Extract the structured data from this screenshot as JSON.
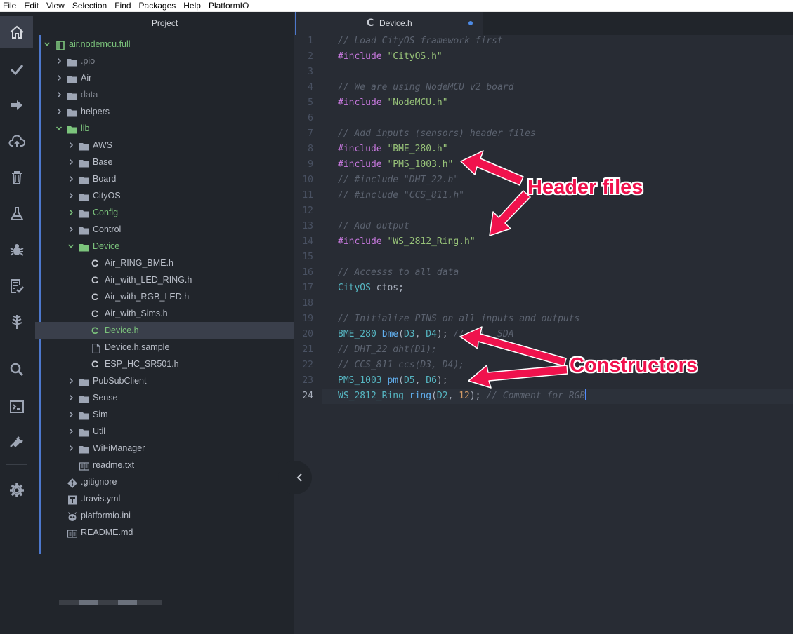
{
  "menubar": {
    "items": [
      "File",
      "Edit",
      "View",
      "Selection",
      "Find",
      "Packages",
      "Help",
      "PlatformIO"
    ]
  },
  "activitybar": {
    "icons": [
      "home-icon",
      "check-icon",
      "arrow-right-icon",
      "cloud-upload-icon",
      "trash-icon",
      "flask-icon",
      "bug-icon",
      "checklist-icon",
      "tree-icon",
      "search-icon",
      "terminal-icon",
      "plug-icon",
      "gear-icon"
    ]
  },
  "sidebar": {
    "title": "Project",
    "tree": [
      {
        "label": "air.nodemcu.full",
        "kind": "project",
        "depth": 0,
        "expanded": true,
        "color": "green"
      },
      {
        "label": ".pio",
        "kind": "folder",
        "depth": 1,
        "expanded": false,
        "color": "dim"
      },
      {
        "label": "Air",
        "kind": "folder",
        "depth": 1,
        "expanded": false
      },
      {
        "label": "data",
        "kind": "folder",
        "depth": 1,
        "expanded": false,
        "color": "dim"
      },
      {
        "label": "helpers",
        "kind": "folder",
        "depth": 1,
        "expanded": false
      },
      {
        "label": "lib",
        "kind": "folder",
        "depth": 1,
        "expanded": true,
        "color": "green"
      },
      {
        "label": "AWS",
        "kind": "folder",
        "depth": 2,
        "expanded": false
      },
      {
        "label": "Base",
        "kind": "folder",
        "depth": 2,
        "expanded": false
      },
      {
        "label": "Board",
        "kind": "folder",
        "depth": 2,
        "expanded": false
      },
      {
        "label": "CityOS",
        "kind": "folder",
        "depth": 2,
        "expanded": false
      },
      {
        "label": "Config",
        "kind": "folder",
        "depth": 2,
        "expanded": false,
        "color": "green"
      },
      {
        "label": "Control",
        "kind": "folder",
        "depth": 2,
        "expanded": false
      },
      {
        "label": "Device",
        "kind": "folder",
        "depth": 2,
        "expanded": true,
        "color": "green"
      },
      {
        "label": "Air_RING_BME.h",
        "kind": "cfile",
        "depth": 3
      },
      {
        "label": "Air_with_LED_RING.h",
        "kind": "cfile",
        "depth": 3
      },
      {
        "label": "Air_with_RGB_LED.h",
        "kind": "cfile",
        "depth": 3
      },
      {
        "label": "Air_with_Sims.h",
        "kind": "cfile",
        "depth": 3
      },
      {
        "label": "Device.h",
        "kind": "cfile",
        "depth": 3,
        "selected": true,
        "color": "green"
      },
      {
        "label": "Device.h.sample",
        "kind": "file",
        "depth": 3
      },
      {
        "label": "ESP_HC_SR501.h",
        "kind": "cfile",
        "depth": 3
      },
      {
        "label": "PubSubClient",
        "kind": "folder",
        "depth": 2,
        "expanded": false
      },
      {
        "label": "Sense",
        "kind": "folder",
        "depth": 2,
        "expanded": false
      },
      {
        "label": "Sim",
        "kind": "folder",
        "depth": 2,
        "expanded": false
      },
      {
        "label": "Util",
        "kind": "folder",
        "depth": 2,
        "expanded": false
      },
      {
        "label": "WiFiManager",
        "kind": "folder",
        "depth": 2,
        "expanded": false
      },
      {
        "label": "readme.txt",
        "kind": "book",
        "depth": 2
      },
      {
        "label": ".gitignore",
        "kind": "git",
        "depth": 1
      },
      {
        "label": ".travis.yml",
        "kind": "yml",
        "depth": 1
      },
      {
        "label": "platformio.ini",
        "kind": "alien",
        "depth": 1
      },
      {
        "label": "README.md",
        "kind": "book",
        "depth": 1
      }
    ]
  },
  "tab": {
    "label": "Device.h",
    "icon": "c-file-icon",
    "modified": true
  },
  "editor": {
    "current_line": 24,
    "lines": [
      [
        [
          "cm",
          "// Load CityOS framework first"
        ]
      ],
      [
        [
          "k",
          "#include"
        ],
        [
          "p",
          " "
        ],
        [
          "s",
          "\"CityOS.h\""
        ]
      ],
      [],
      [
        [
          "cm",
          "// We are using NodeMCU v2 board"
        ]
      ],
      [
        [
          "k",
          "#include"
        ],
        [
          "p",
          " "
        ],
        [
          "s",
          "\"NodeMCU.h\""
        ]
      ],
      [],
      [
        [
          "cm",
          "// Add inputs (sensors) header files"
        ]
      ],
      [
        [
          "k",
          "#include"
        ],
        [
          "p",
          " "
        ],
        [
          "s",
          "\"BME_280.h\""
        ]
      ],
      [
        [
          "k",
          "#include"
        ],
        [
          "p",
          " "
        ],
        [
          "s",
          "\"PMS_1003.h\""
        ]
      ],
      [
        [
          "cm",
          "// #include \"DHT_22.h\""
        ]
      ],
      [
        [
          "cm",
          "// #include \"CCS_811.h\""
        ]
      ],
      [],
      [
        [
          "cm",
          "// Add output"
        ]
      ],
      [
        [
          "k",
          "#include"
        ],
        [
          "p",
          " "
        ],
        [
          "s",
          "\"WS_2812_Ring.h\""
        ]
      ],
      [],
      [
        [
          "cm",
          "// Accesss to all data"
        ]
      ],
      [
        [
          "t",
          "CityOS"
        ],
        [
          "p",
          " ctos;"
        ]
      ],
      [],
      [
        [
          "cm",
          "// Initialize PINS on all inputs and outputs"
        ]
      ],
      [
        [
          "t",
          "BME_280"
        ],
        [
          "p",
          " "
        ],
        [
          "f",
          "bme"
        ],
        [
          "p",
          "("
        ],
        [
          "t",
          "D3"
        ],
        [
          "p",
          ", "
        ],
        [
          "t",
          "D4"
        ],
        [
          "p",
          "); "
        ],
        [
          "cm",
          "// SCL, SDA"
        ]
      ],
      [
        [
          "cm",
          "// DHT_22 dht(D1);"
        ]
      ],
      [
        [
          "cm",
          "// CCS_811 ccs(D3, D4);"
        ]
      ],
      [
        [
          "t",
          "PMS_1003"
        ],
        [
          "p",
          " "
        ],
        [
          "f",
          "pm"
        ],
        [
          "p",
          "("
        ],
        [
          "t",
          "D5"
        ],
        [
          "p",
          ", "
        ],
        [
          "t",
          "D6"
        ],
        [
          "p",
          ");"
        ]
      ],
      [
        [
          "t",
          "WS_2812_Ring"
        ],
        [
          "p",
          " "
        ],
        [
          "f",
          "ring"
        ],
        [
          "p",
          "("
        ],
        [
          "t",
          "D2"
        ],
        [
          "p",
          ", "
        ],
        [
          "n",
          "12"
        ],
        [
          "p",
          "); "
        ],
        [
          "cm",
          "// Comment for RGB"
        ]
      ]
    ]
  },
  "annotations": {
    "header_files": "Header files",
    "constructors": "Constructors",
    "color": "#f0124d"
  },
  "colors": {
    "accent": "#4d78cc",
    "green_text": "#7cc47c",
    "bg": "#282c34",
    "sidebar_bg": "#21252b"
  }
}
